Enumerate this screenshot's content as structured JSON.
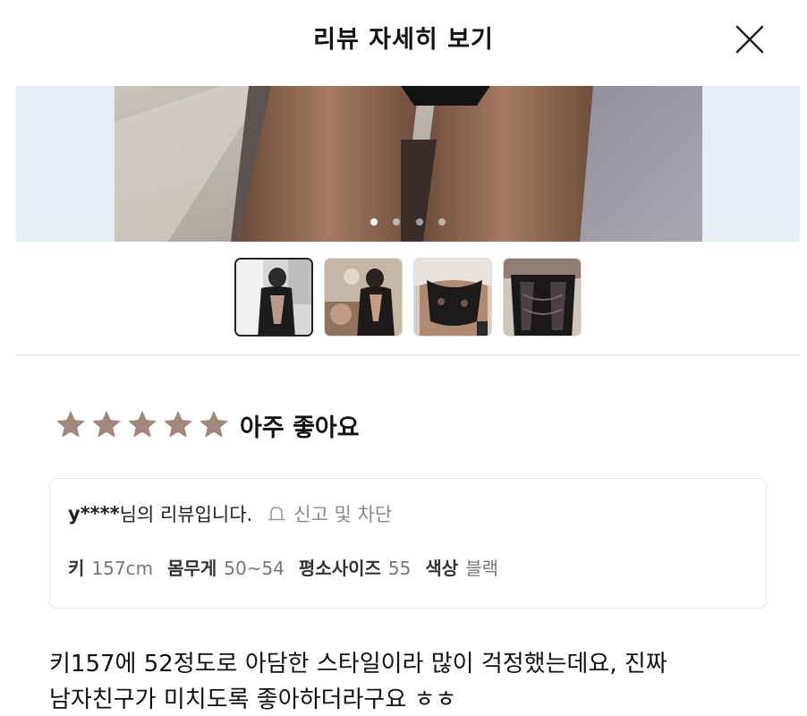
{
  "header": {
    "title": "리뷰 자세히 보기",
    "close_icon": "close-icon"
  },
  "gallery": {
    "current_index": 0,
    "photo_count": 4,
    "thumbnail_count": 4,
    "selected_thumbnail": 0,
    "colors": {
      "background": "#e8edf5"
    }
  },
  "rating": {
    "stars": 5,
    "max_stars": 5,
    "label": "아주 좋아요",
    "star_color": "#a1877c"
  },
  "reviewer": {
    "id": "y****",
    "suffix": "님의 리뷰입니다.",
    "report_label": "신고 및 차단",
    "report_icon": "bell-icon"
  },
  "specs": [
    {
      "key": "키",
      "value": "157cm"
    },
    {
      "key": "몸무게",
      "value": "50~54"
    },
    {
      "key": "평소사이즈",
      "value": "55"
    },
    {
      "key": "색상",
      "value": "블랙"
    }
  ],
  "review": {
    "line1": "키157에 52정도로 아담한 스타일이라 많이 걱정했는데요, 진짜",
    "line2": "남자친구가 미치도록 좋아하더라구요 ㅎㅎ"
  }
}
